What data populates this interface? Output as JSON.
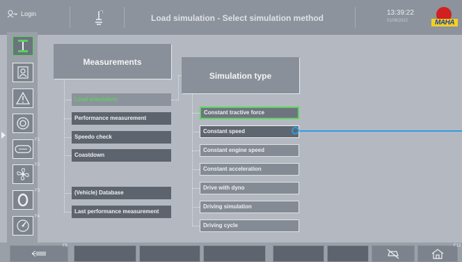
{
  "header": {
    "login_label": "Login",
    "title": "Load simulation - Select simulation method",
    "time": "13:39:22",
    "date": "01/06/2022",
    "logo_text": "MAHA"
  },
  "sidebar": {
    "keys": [
      "F1",
      "F2",
      "F3",
      "F4"
    ]
  },
  "measurements": {
    "title": "Measurements",
    "items": [
      "Load simulation",
      "Performance measurement",
      "Speedo check",
      "Coastdown",
      "(Vehicle) Database",
      "Last performance measurement"
    ]
  },
  "simulation": {
    "title": "Simulation type",
    "items": [
      "Constant tractive force",
      "Constant speed",
      "Constant engine speed",
      "Constant acceleration",
      "Drive with dyno",
      "Driving simulation",
      "Driving cycle"
    ]
  },
  "bottom": {
    "keys": [
      "F8",
      "F12"
    ]
  },
  "colors": {
    "accent_green": "#5cd461",
    "pointer_blue": "#2b9ee0"
  }
}
